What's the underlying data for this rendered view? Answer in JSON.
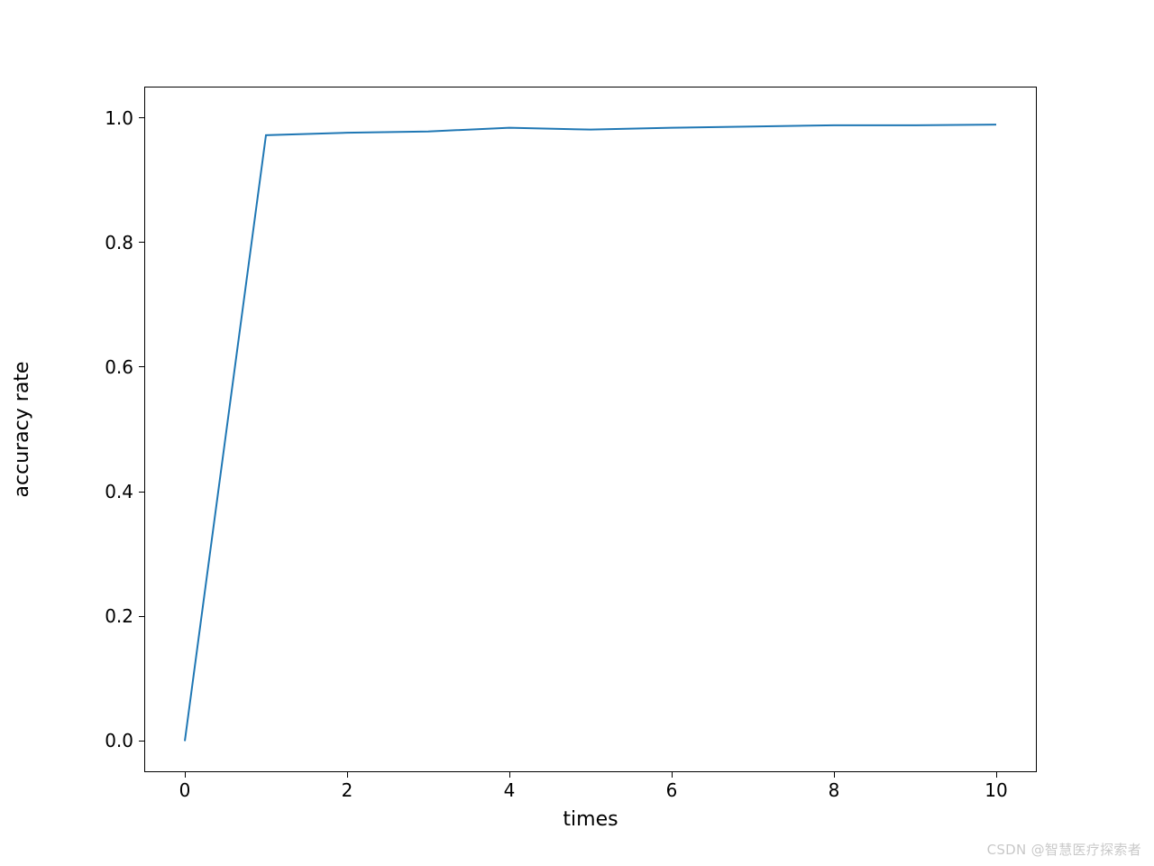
{
  "chart_data": {
    "type": "line",
    "x": [
      0,
      1,
      2,
      3,
      4,
      5,
      6,
      7,
      8,
      9,
      10
    ],
    "values": [
      0.0,
      0.972,
      0.976,
      0.978,
      0.984,
      0.981,
      0.984,
      0.986,
      0.988,
      0.988,
      0.989
    ],
    "xlabel": "times",
    "ylabel": "accuracy rate",
    "title": "",
    "xlim": [
      -0.5,
      10.5
    ],
    "ylim": [
      -0.05,
      1.05
    ],
    "x_ticks": [
      0,
      2,
      4,
      6,
      8,
      10
    ],
    "y_ticks": [
      0.0,
      0.2,
      0.4,
      0.6,
      0.8,
      1.0
    ],
    "x_tick_labels": [
      "0",
      "2",
      "4",
      "6",
      "8",
      "10"
    ],
    "y_tick_labels": [
      "0.0",
      "0.2",
      "0.4",
      "0.6",
      "0.8",
      "1.0"
    ],
    "line_color": "#1f77b4"
  },
  "watermark": "CSDN @智慧医疗探索者"
}
